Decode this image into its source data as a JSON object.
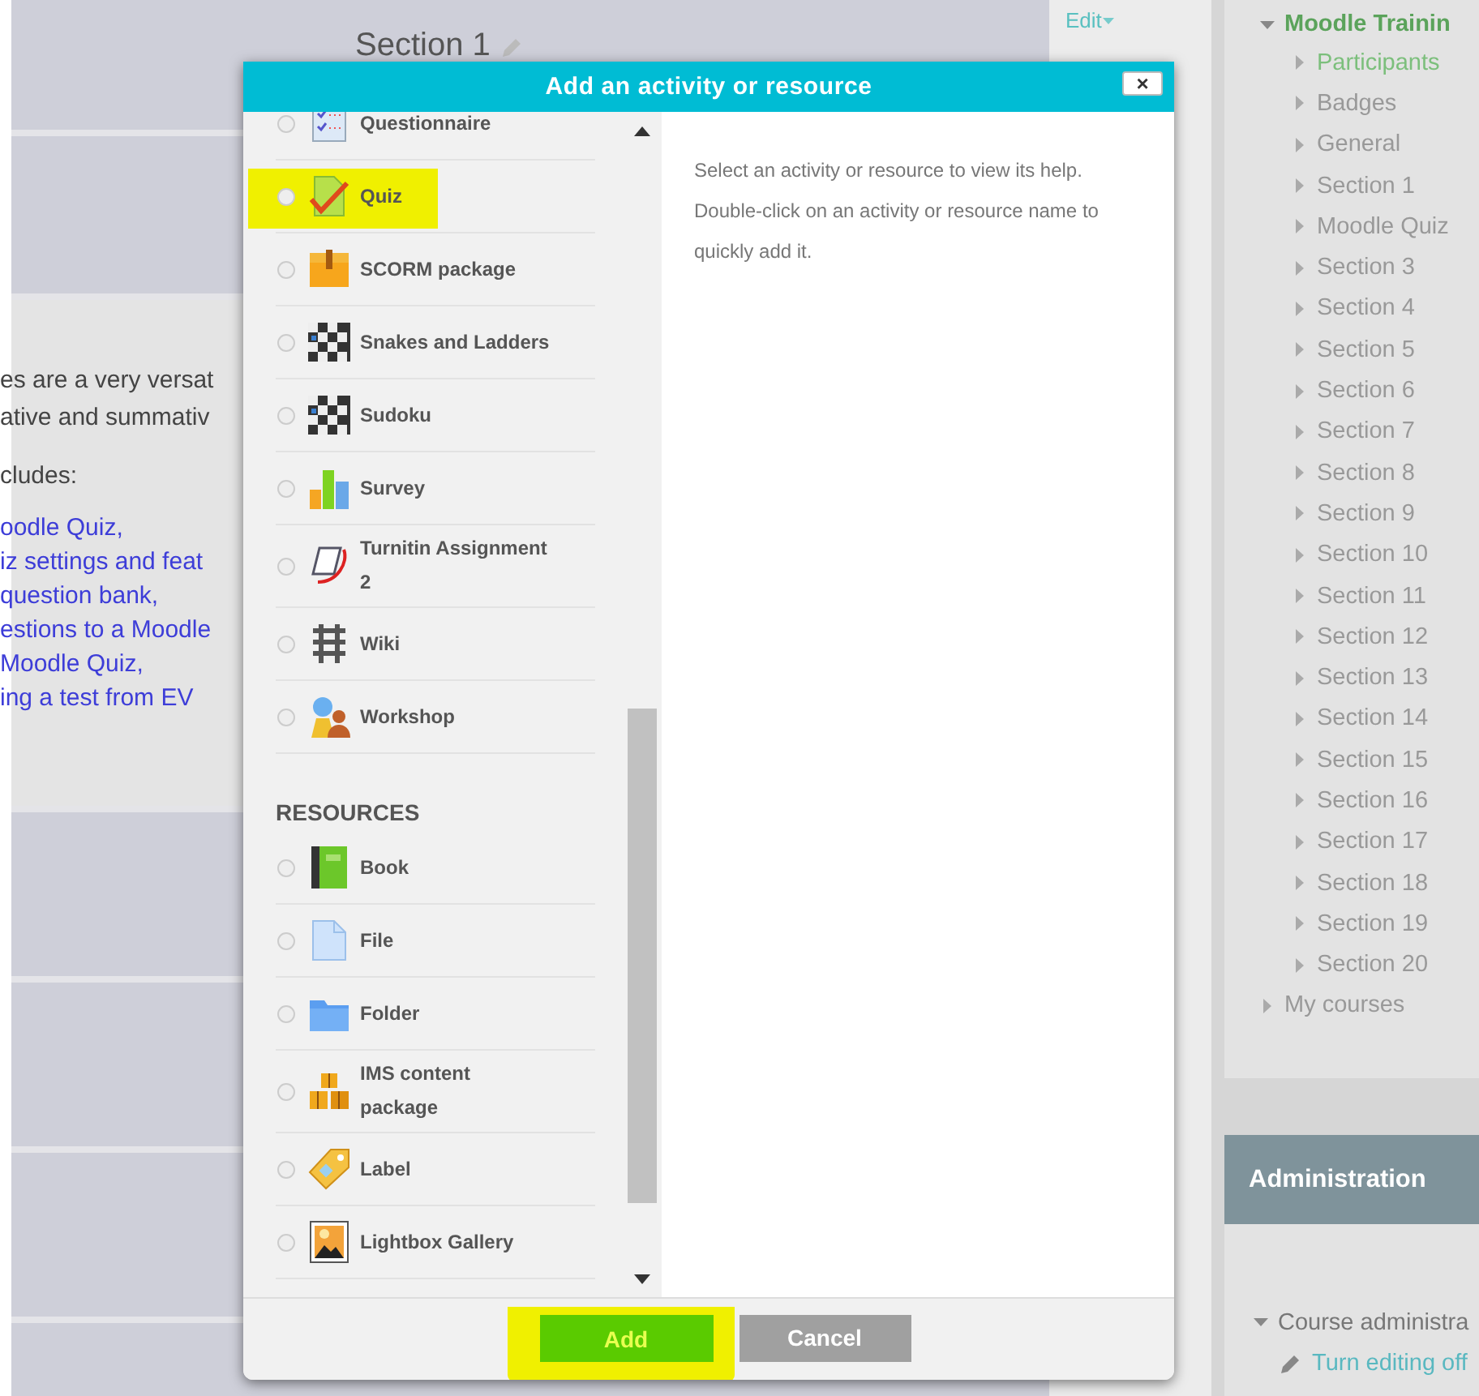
{
  "section": {
    "title": "Section 1"
  },
  "summary": {
    "lines": [
      "es are a very versat",
      "ative and summativ"
    ],
    "intro": "cludes:",
    "links": [
      "oodle Quiz,",
      "iz settings and feat",
      "question bank,",
      "estions to a Moodle",
      "Moodle Quiz,",
      "ing a test from EV"
    ]
  },
  "edit_menu": {
    "label": "Edit"
  },
  "navigation": {
    "course": {
      "label": "Moodle Trainin",
      "expanded": true,
      "children": [
        {
          "label": "Participants",
          "kind": "link",
          "expanded": false
        },
        {
          "label": "Badges",
          "kind": "node",
          "expanded": false
        },
        {
          "label": "General",
          "kind": "node",
          "expanded": false
        },
        {
          "label": "Section 1",
          "kind": "node",
          "expanded": false
        },
        {
          "label": "Moodle Quiz",
          "kind": "node",
          "expanded": false
        },
        {
          "label": "Section 3",
          "kind": "node",
          "expanded": false
        },
        {
          "label": "Section 4",
          "kind": "node",
          "expanded": false
        },
        {
          "label": "Section 5",
          "kind": "node",
          "expanded": false
        },
        {
          "label": "Section 6",
          "kind": "node",
          "expanded": false
        },
        {
          "label": "Section 7",
          "kind": "node",
          "expanded": false
        },
        {
          "label": "Section 8",
          "kind": "node",
          "expanded": false
        },
        {
          "label": "Section 9",
          "kind": "node",
          "expanded": false
        },
        {
          "label": "Section 10",
          "kind": "node",
          "expanded": false
        },
        {
          "label": "Section 11",
          "kind": "node",
          "expanded": false
        },
        {
          "label": "Section 12",
          "kind": "node",
          "expanded": false
        },
        {
          "label": "Section 13",
          "kind": "node",
          "expanded": false
        },
        {
          "label": "Section 14",
          "kind": "node",
          "expanded": false
        },
        {
          "label": "Section 15",
          "kind": "node",
          "expanded": false
        },
        {
          "label": "Section 16",
          "kind": "node",
          "expanded": false
        },
        {
          "label": "Section 17",
          "kind": "node",
          "expanded": false
        },
        {
          "label": "Section 18",
          "kind": "node",
          "expanded": false
        },
        {
          "label": "Section 19",
          "kind": "node",
          "expanded": false
        },
        {
          "label": "Section 20",
          "kind": "node",
          "expanded": false
        }
      ]
    },
    "my_courses": {
      "label": "My courses",
      "expanded": false
    }
  },
  "administration": {
    "title": "Administration",
    "course_admin": {
      "label": "Course administra",
      "expanded": true
    },
    "items": [
      "Turn editing off"
    ]
  },
  "dialog": {
    "title": "Add an activity or resource",
    "close": "×",
    "list": [
      {
        "kind": "item",
        "label": "Questionnaire",
        "selected": false,
        "highlighted": false
      },
      {
        "kind": "item",
        "label": "Quiz",
        "selected": false,
        "highlighted": true
      },
      {
        "kind": "item",
        "label": "SCORM package",
        "selected": false,
        "highlighted": false
      },
      {
        "kind": "item",
        "label": "Snakes and Ladders",
        "selected": false,
        "highlighted": false
      },
      {
        "kind": "item",
        "label": "Sudoku",
        "selected": false,
        "highlighted": false
      },
      {
        "kind": "item",
        "label": "Survey",
        "selected": false,
        "highlighted": false
      },
      {
        "kind": "item",
        "label": "Turnitin Assignment 2",
        "selected": false,
        "highlighted": false
      },
      {
        "kind": "item",
        "label": "Wiki",
        "selected": false,
        "highlighted": false
      },
      {
        "kind": "item",
        "label": "Workshop",
        "selected": false,
        "highlighted": false
      },
      {
        "kind": "heading",
        "label": "RESOURCES"
      },
      {
        "kind": "item",
        "label": "Book",
        "selected": false,
        "highlighted": false
      },
      {
        "kind": "item",
        "label": "File",
        "selected": false,
        "highlighted": false
      },
      {
        "kind": "item",
        "label": "Folder",
        "selected": false,
        "highlighted": false
      },
      {
        "kind": "item",
        "label": "IMS content package",
        "selected": false,
        "highlighted": false
      },
      {
        "kind": "item",
        "label": "Label",
        "selected": false,
        "highlighted": false
      },
      {
        "kind": "item",
        "label": "Lightbox Gallery",
        "selected": false,
        "highlighted": false
      }
    ],
    "help": [
      "Select an activity or resource to view its help.",
      "Double-click on an activity or resource name to quickly add it."
    ],
    "buttons": [
      {
        "label": "Add",
        "kind": "primary",
        "highlighted": true
      },
      {
        "label": "Cancel",
        "kind": "secondary",
        "highlighted": false
      }
    ]
  }
}
